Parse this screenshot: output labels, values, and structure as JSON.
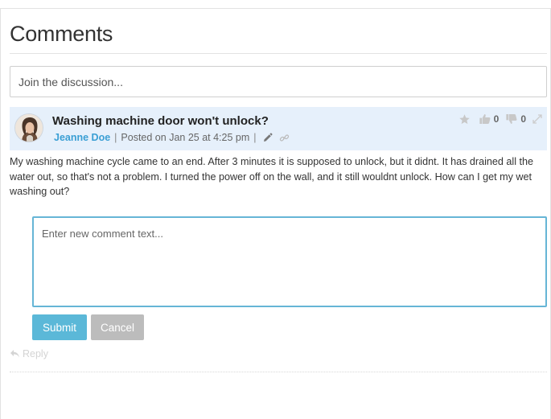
{
  "page": {
    "title": "Comments"
  },
  "discussion": {
    "placeholder": "Join the discussion..."
  },
  "comment": {
    "title": "Washing machine door won't unlock?",
    "author": "Jeanne Doe",
    "posted": "Posted on Jan 25 at 4:25 pm",
    "separator": "|",
    "upvotes": "0",
    "downvotes": "0",
    "body": "My washing machine cycle came to an end. After 3 minutes it is supposed to unlock, but it didnt. It has drained all the water out, so that's not a problem. I turned the power off on the wall, and it still wouldnt unlock. How can I get my wet washing out?",
    "icons": {
      "avatar": "avatar",
      "edit": "pencil-icon",
      "link": "link-icon",
      "favorite": "star-icon",
      "upvote": "thumbs-up-icon",
      "downvote": "thumbs-down-icon",
      "expand": "expand-icon"
    }
  },
  "reply_form": {
    "placeholder": "Enter new comment text...",
    "submit_label": "Submit",
    "cancel_label": "Cancel",
    "reply_label": "Reply",
    "reply_icon": "reply-icon"
  },
  "colors": {
    "accent": "#3a9fd4",
    "header_bg": "#e6f0fb",
    "submit_bg": "#5bb8d8",
    "cancel_bg": "#bcbcbc",
    "focus_border": "#66b5d6"
  }
}
